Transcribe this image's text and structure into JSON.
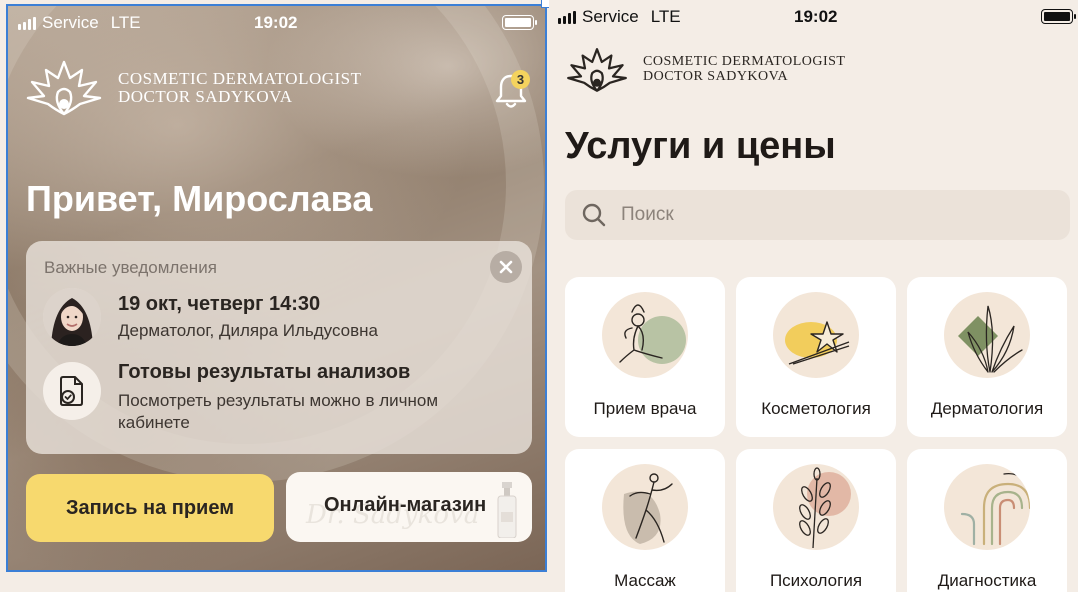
{
  "left": {
    "status": {
      "carrier": "Service",
      "network": "LTE",
      "time": "19:02"
    },
    "brand": {
      "line1": "COSMETIC DERMATOLOGIST",
      "line2": "DOCTOR SADYKOVA"
    },
    "notifications_count": "3",
    "greeting": "Привет, Мирослава",
    "notifications": {
      "title": "Важные уведомления",
      "appointment": {
        "datetime": "19 окт, четверг 14:30",
        "doctor": "Дерматолог, Диляра Ильдусовна"
      },
      "results": {
        "title": "Готовы результаты анализов",
        "text": "Посмотреть результаты можно в личном кабинете"
      }
    },
    "buttons": {
      "book": "Запись на прием",
      "shop": "Онлайн-магазин",
      "shop_script": "Dr. Sadykova"
    }
  },
  "right": {
    "status": {
      "carrier": "Service",
      "network": "LTE",
      "time": "19:02"
    },
    "brand": {
      "line1": "COSMETIC DERMATOLOGIST",
      "line2": "DOCTOR SADYKOVA"
    },
    "title": "Услуги и цены",
    "search": {
      "placeholder": "Поиск"
    },
    "services": [
      {
        "label": "Прием врача",
        "icon": "yoga-pose-icon"
      },
      {
        "label": "Косметология",
        "icon": "vanilla-flower-icon"
      },
      {
        "label": "Дерматология",
        "icon": "leaves-icon"
      },
      {
        "label": "Массаж",
        "icon": "ballerina-icon"
      },
      {
        "label": "Психология",
        "icon": "branch-icon"
      },
      {
        "label": "Диагностика",
        "icon": "rainbow-icon"
      }
    ]
  },
  "colors": {
    "accent_yellow": "#f7d96e",
    "background": "#f4ede6",
    "selection": "#3b7fd6"
  }
}
